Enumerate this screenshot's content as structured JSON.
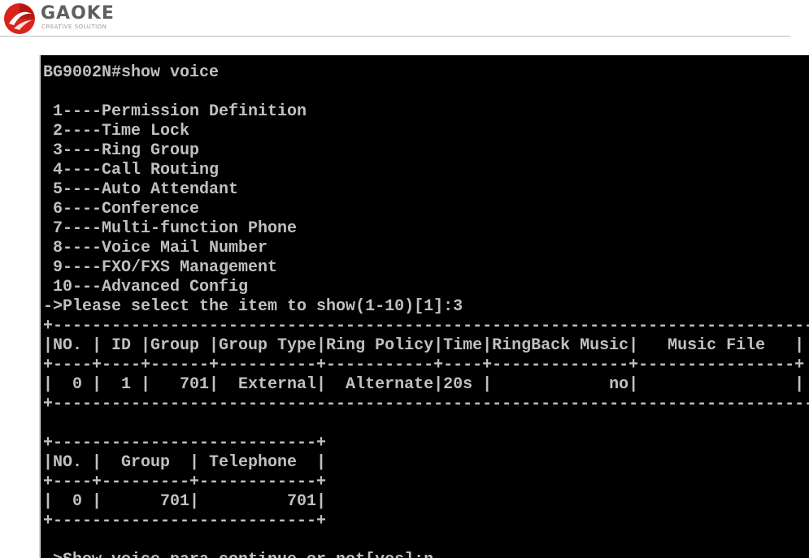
{
  "brand": {
    "name": "GAOKE",
    "tagline": "CREATIVE SOLUTION"
  },
  "terminal": {
    "lines": [
      "BG9002N#show voice",
      "",
      " 1----Permission Definition",
      " 2----Time Lock",
      " 3----Ring Group",
      " 4----Call Routing",
      " 5----Auto Attendant",
      " 6----Conference",
      " 7----Multi-function Phone",
      " 8----Voice Mail Number",
      " 9----FXO/FXS Management",
      " 10---Advanced Config",
      "->Please select the item to show(1-10)[1]:3",
      "+----------------------------------------------------------------------------------+",
      "|NO. | ID |Group |Group Type|Ring Policy|Time|RingBack Music|   Music File   |",
      "+----+----+------+----------+-----------+----+--------------+----------------+",
      "|  0 |  1 |   701|  External|  Alternate|20s |            no|                |",
      "+----------------------------------------------------------------------------------+",
      "",
      "+---------------------------+",
      "|NO. |  Group  | Telephone  |",
      "+----+---------+------------+",
      "|  0 |      701|         701|",
      "+---------------------------+",
      "",
      "->Show voice para continue or not[yes]:n"
    ]
  },
  "colors": {
    "terminal_bg": "#000000",
    "terminal_fg": "#c0c0c0",
    "brand_red": "#d9231d",
    "brand_gray": "#5f5f5f"
  },
  "icons": {
    "logo": "gaoke-logo-icon"
  }
}
